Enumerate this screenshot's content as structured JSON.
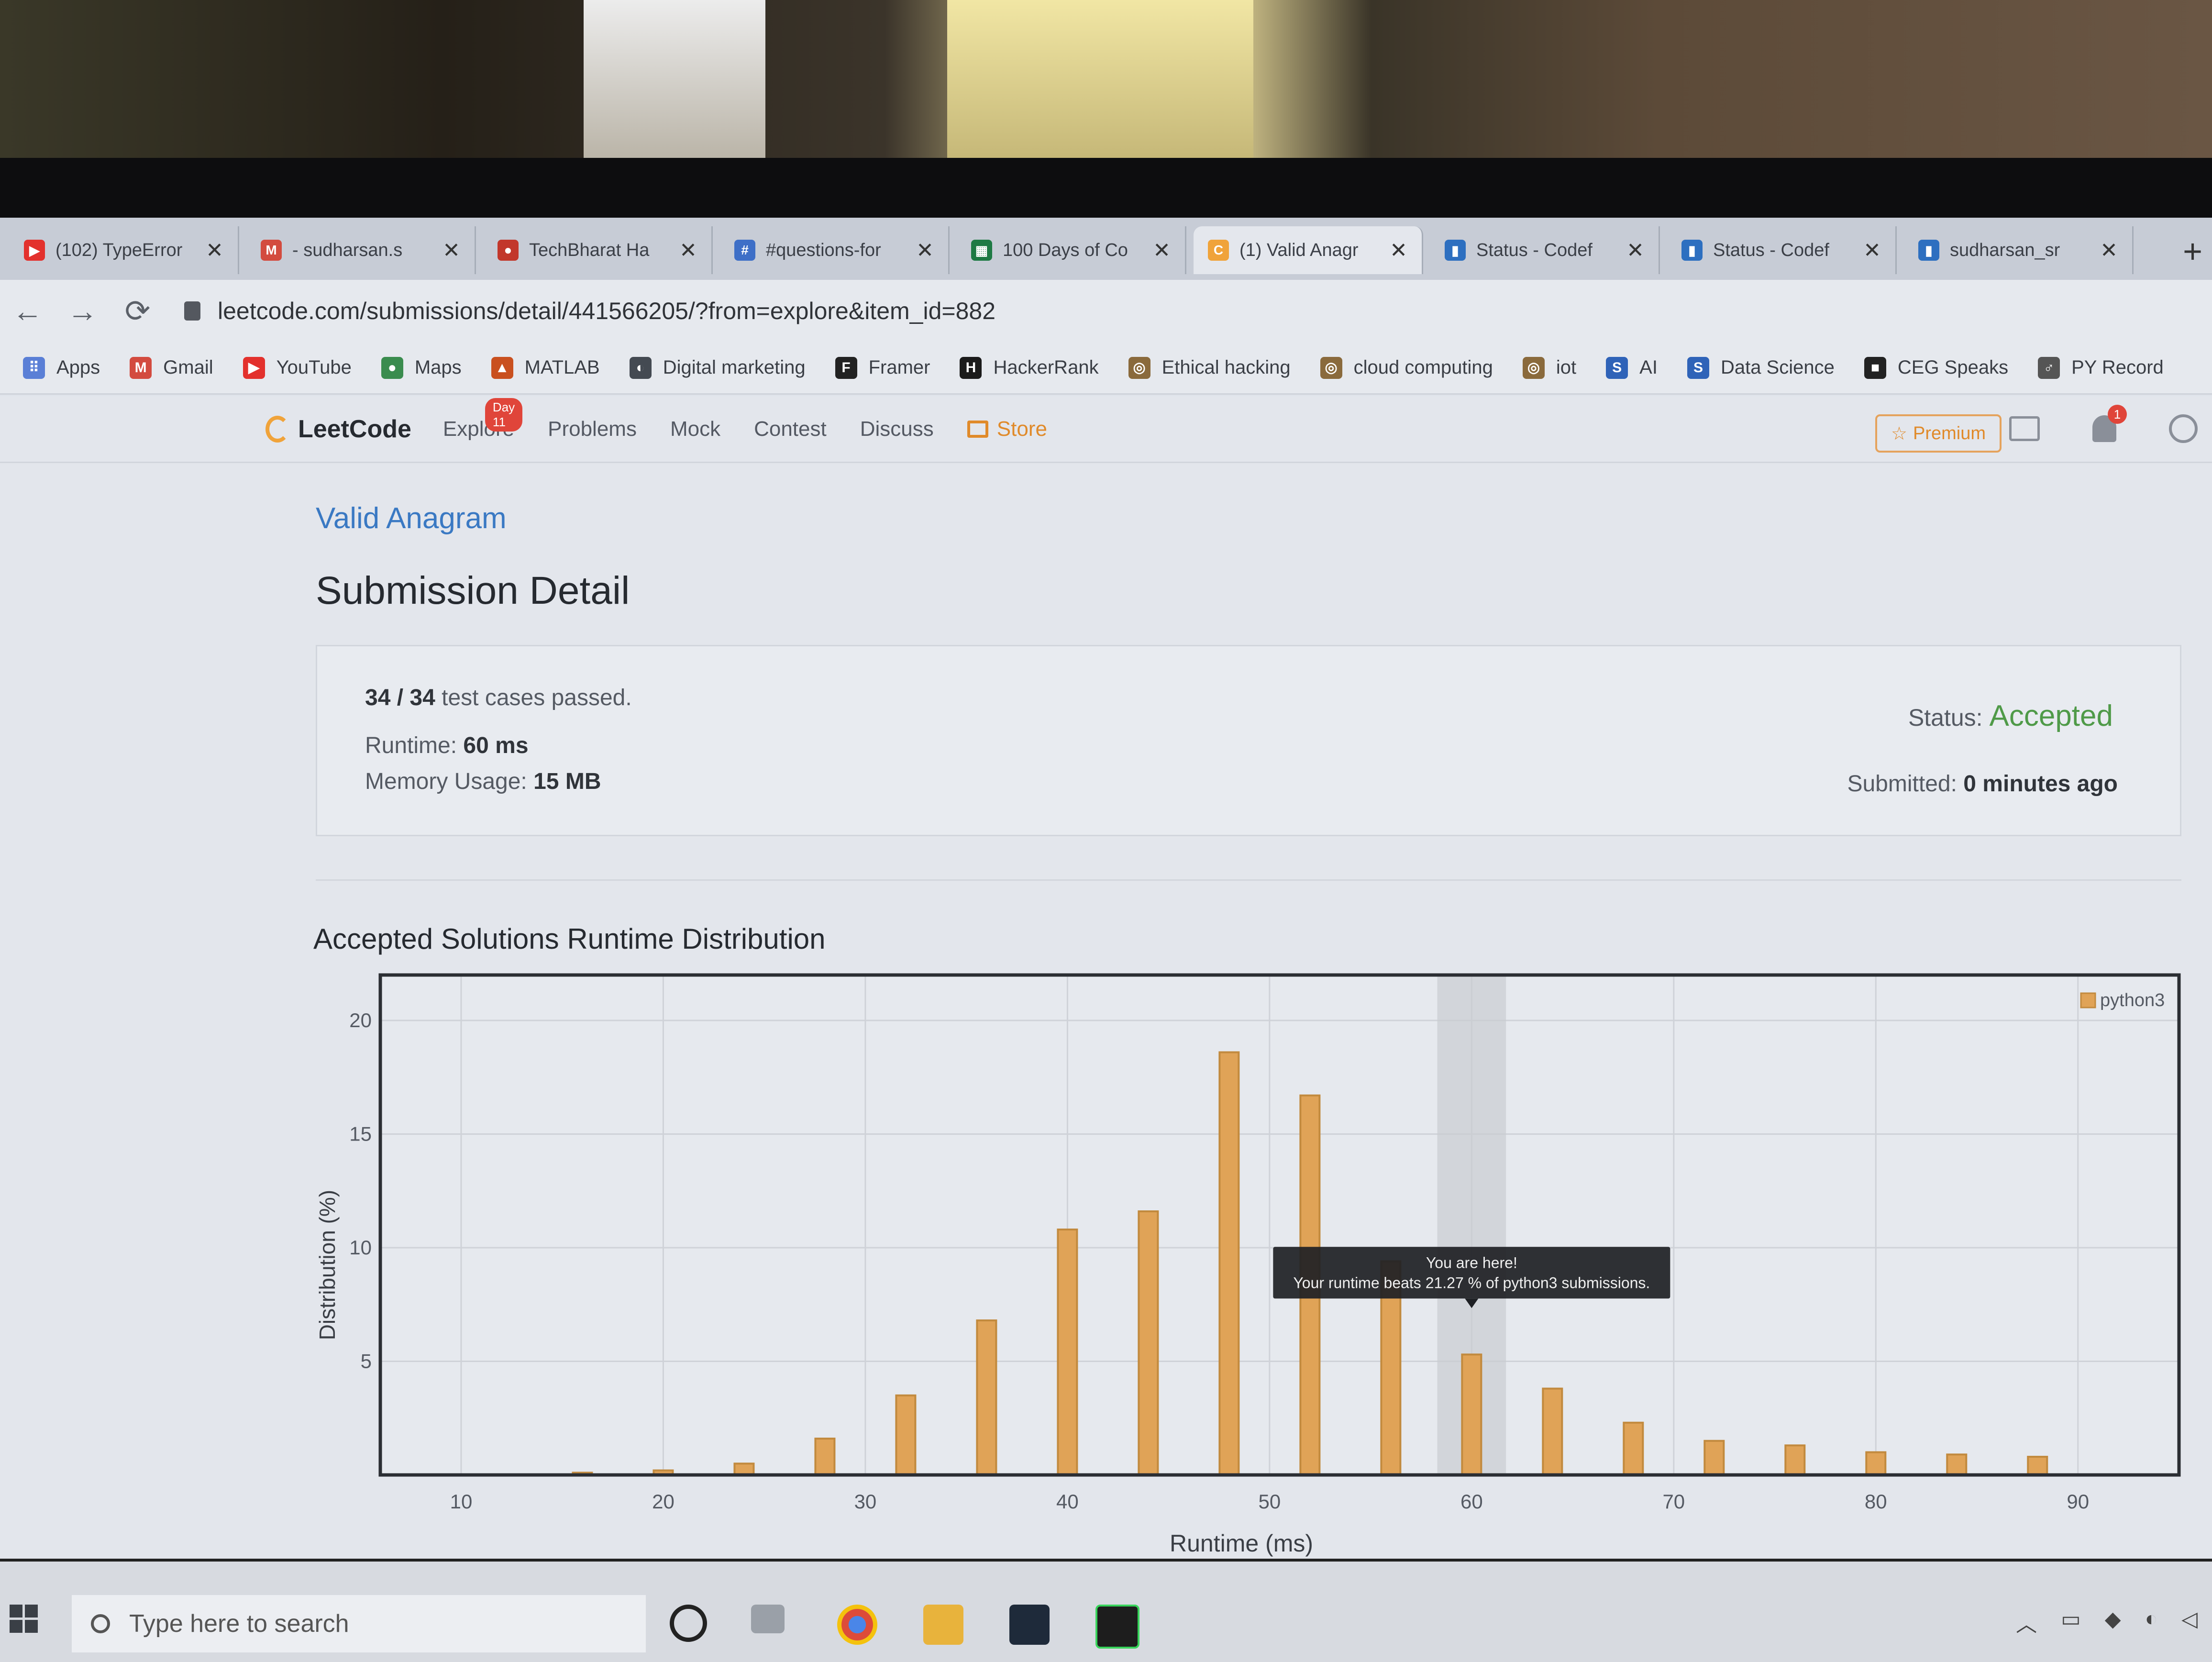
{
  "tabs": [
    {
      "title": "(102) TypeError",
      "icon": "youtube-icon",
      "color": "#e3312d",
      "active": false
    },
    {
      "title": "- sudharsan.s",
      "icon": "gmail-icon",
      "color": "#d34b3f",
      "active": false
    },
    {
      "title": "TechBharat Ha",
      "icon": "techbharat-icon",
      "color": "#c2372b",
      "active": false
    },
    {
      "title": "#questions-for",
      "icon": "slack-icon",
      "color": "#3e6fc7",
      "active": false
    },
    {
      "title": "100 Days of Co",
      "icon": "sheets-icon",
      "color": "#1e7a44",
      "active": false
    },
    {
      "title": "(1) Valid Anagr",
      "icon": "leetcode-icon",
      "color": "#f0a33a",
      "active": true
    },
    {
      "title": "Status - Codef",
      "icon": "codeforces-icon",
      "color": "#2d6fc0",
      "active": false
    },
    {
      "title": "Status - Codef",
      "icon": "codeforces-icon",
      "color": "#2d6fc0",
      "active": false
    },
    {
      "title": "sudharsan_sr",
      "icon": "codeforces-icon",
      "color": "#2d6fc0",
      "active": false
    }
  ],
  "new_tab": "+",
  "address_bar": {
    "back": "←",
    "forward": "→",
    "reload": "⟳",
    "url": "leetcode.com/submissions/detail/441566205/?from=explore&item_id=882"
  },
  "bookmarks": [
    {
      "label": "Apps",
      "icon": "apps-grid-icon",
      "color": "#5a7fd6",
      "glyph": "⠿"
    },
    {
      "label": "Gmail",
      "icon": "gmail-icon",
      "color": "#d34b3f",
      "glyph": "M"
    },
    {
      "label": "YouTube",
      "icon": "youtube-icon",
      "color": "#e3312d",
      "glyph": "▶"
    },
    {
      "label": "Maps",
      "icon": "maps-pin-icon",
      "color": "#3a8c4e",
      "glyph": "●"
    },
    {
      "label": "MATLAB",
      "icon": "matlab-icon",
      "color": "#c9501f",
      "glyph": "▲"
    },
    {
      "label": "Digital marketing",
      "icon": "globe-icon",
      "color": "#444a52",
      "glyph": "◐"
    },
    {
      "label": "Framer",
      "icon": "framer-icon",
      "color": "#222",
      "glyph": "F"
    },
    {
      "label": "HackerRank",
      "icon": "hackerrank-icon",
      "color": "#1b1b1b",
      "glyph": "H"
    },
    {
      "label": "Ethical hacking",
      "icon": "hacking-icon",
      "color": "#8a6a3c",
      "glyph": "◎"
    },
    {
      "label": "cloud computing",
      "icon": "cloud-icon",
      "color": "#8a6a3c",
      "glyph": "◎"
    },
    {
      "label": "iot",
      "icon": "iot-icon",
      "color": "#8a6a3c",
      "glyph": "◎"
    },
    {
      "label": "AI",
      "icon": "s-icon",
      "color": "#2f63b8",
      "glyph": "S"
    },
    {
      "label": "Data Science",
      "icon": "s-icon",
      "color": "#2f63b8",
      "glyph": "S"
    },
    {
      "label": "CEG Speaks",
      "icon": "ceg-icon",
      "color": "#222",
      "glyph": "■"
    },
    {
      "label": "PY Record",
      "icon": "py-icon",
      "color": "#555",
      "glyph": "♂"
    }
  ],
  "lc_nav": {
    "brand": "LeetCode",
    "explore": "Explore",
    "explore_badge": "Day 11",
    "problems": "Problems",
    "mock": "Mock",
    "contest": "Contest",
    "discuss": "Discuss",
    "store": "Store",
    "premium": "Premium",
    "notification_count": "1"
  },
  "problem_title": "Valid Anagram",
  "page_title": "Submission Detail",
  "result": {
    "passed": "34 / 34",
    "passed_suffix": "test cases passed.",
    "runtime_label": "Runtime:",
    "runtime_value": "60 ms",
    "memory_label": "Memory Usage:",
    "memory_value": "15 MB",
    "status_label": "Status:",
    "status_value": "Accepted",
    "submitted_label": "Submitted:",
    "submitted_value": "0 minutes ago"
  },
  "chart_title": "Accepted Solutions Runtime Distribution",
  "chart_data": {
    "type": "bar",
    "xlabel": "Runtime (ms)",
    "ylabel": "Distribution (%)",
    "xlim": [
      6,
      95
    ],
    "ylim": [
      0,
      22
    ],
    "xticks": [
      10,
      20,
      30,
      40,
      50,
      60,
      70,
      80,
      90
    ],
    "yticks": [
      5,
      10,
      15,
      20
    ],
    "grid": true,
    "legend_position": "top-right",
    "series": [
      {
        "name": "python3",
        "color": "#e0a357",
        "x": [
          16,
          20,
          24,
          28,
          32,
          36,
          40,
          44,
          48,
          52,
          56,
          60,
          64,
          68,
          72,
          76,
          80,
          84,
          88
        ],
        "values": [
          0.1,
          0.2,
          0.5,
          1.6,
          3.5,
          6.8,
          10.8,
          11.6,
          18.6,
          16.7,
          9.4,
          5.3,
          3.8,
          2.3,
          1.5,
          1.3,
          1.0,
          0.9,
          0.8
        ]
      }
    ],
    "highlight_x": 60,
    "tooltip": {
      "line1": "You are here!",
      "line2": "Your runtime beats 21.27 % of python3 submissions."
    }
  },
  "taskbar": {
    "search_placeholder": "Type here to search"
  }
}
